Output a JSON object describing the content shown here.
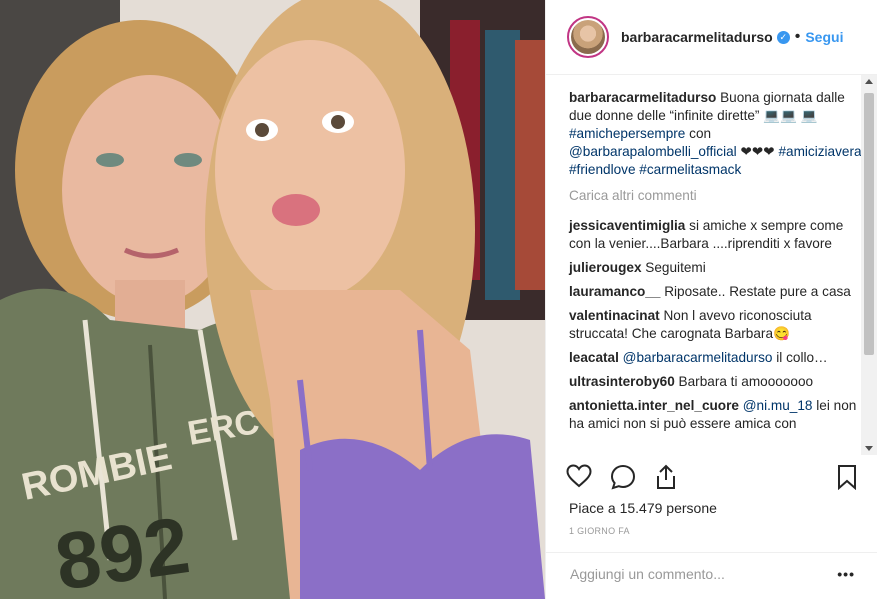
{
  "post": {
    "username": "barbaracarmelitadurso",
    "verified_glyph": "✓",
    "separator": "•",
    "follow_label": "Segui"
  },
  "caption": {
    "author": "barbaracarmelitadurso",
    "text_1": "Buona giornata dalle due donne delle “infinite dirette”",
    "emoji_1": "💻💻",
    "emoji_2": "💻",
    "hashtag_1": "#amichepersempre",
    "text_2": "con",
    "mention_1": "@barbarapalombelli_official",
    "hearts": "❤❤❤",
    "hashtag_2": "#amiciziavera",
    "hashtag_3": "#friendlove",
    "hashtag_4": "#carmelitasmack"
  },
  "load_more_label": "Carica altri commenti",
  "comments": [
    {
      "user": "jessicaventimiglia",
      "text": "si amiche x sempre come con la venier....Barbara ....riprenditi x favore"
    },
    {
      "user": "julierougex",
      "text": "Seguitemi"
    },
    {
      "user": "lauramanco__",
      "text": "Riposate.. Restate pure a casa"
    },
    {
      "user": "valentinacinat",
      "text": "Non l avevo riconosciuta struccata! Che carognata Barbara😋"
    },
    {
      "user": "leacatal",
      "mention": "@barbaracarmelitadurso",
      "text": "il collo…"
    },
    {
      "user": "ultrasinteroby60",
      "text": "Barbara ti amooooooo"
    },
    {
      "user": "antonietta.inter_nel_cuore",
      "mention": "@ni.mu_18",
      "text": "lei non ha amici non si può essere amica con"
    }
  ],
  "likes_label": "Piace a 15.479 persone",
  "date_label": "1 GIORNO FA",
  "add_comment_placeholder": "Aggiungi un commento...",
  "more_options": "•••",
  "photo_text": {
    "hoodie_line_1": "ERC",
    "hoodie_line_2": "ROMBIE",
    "hoodie_number": "892"
  },
  "colors": {
    "link_blue": "#3897f0",
    "tag_blue": "#003569",
    "muted": "#999999",
    "text": "#262626",
    "hoodie_green": "#6f7a5c",
    "lingerie_purple": "#8b6fc7"
  },
  "icons": [
    "heart-icon",
    "comment-icon",
    "share-icon",
    "bookmark-icon",
    "verified-badge-icon"
  ]
}
